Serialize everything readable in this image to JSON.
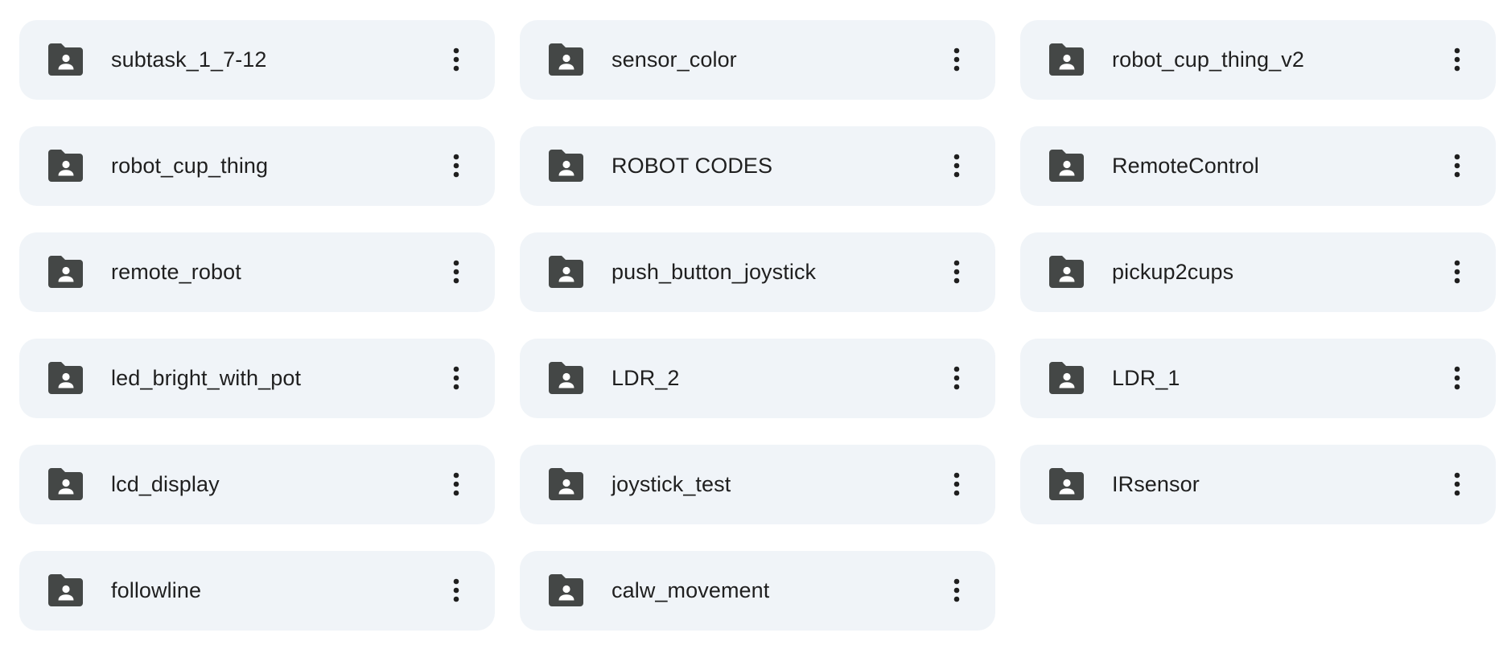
{
  "folders": [
    {
      "name": "subtask_1_7-12"
    },
    {
      "name": "sensor_color"
    },
    {
      "name": "robot_cup_thing_v2"
    },
    {
      "name": "robot_cup_thing"
    },
    {
      "name": "ROBOT CODES"
    },
    {
      "name": "RemoteControl"
    },
    {
      "name": "remote_robot"
    },
    {
      "name": "push_button_joystick"
    },
    {
      "name": "pickup2cups"
    },
    {
      "name": "led_bright_with_pot"
    },
    {
      "name": "LDR_2"
    },
    {
      "name": "LDR_1"
    },
    {
      "name": "lcd_display"
    },
    {
      "name": "joystick_test"
    },
    {
      "name": "IRsensor"
    },
    {
      "name": "followline"
    },
    {
      "name": "calw_movement"
    }
  ],
  "icons": {
    "folder": "shared-folder-icon",
    "more": "more-vert-icon"
  },
  "colors": {
    "card_background": "#f0f4f8",
    "icon": "#444746",
    "text": "#1f1f1f"
  }
}
